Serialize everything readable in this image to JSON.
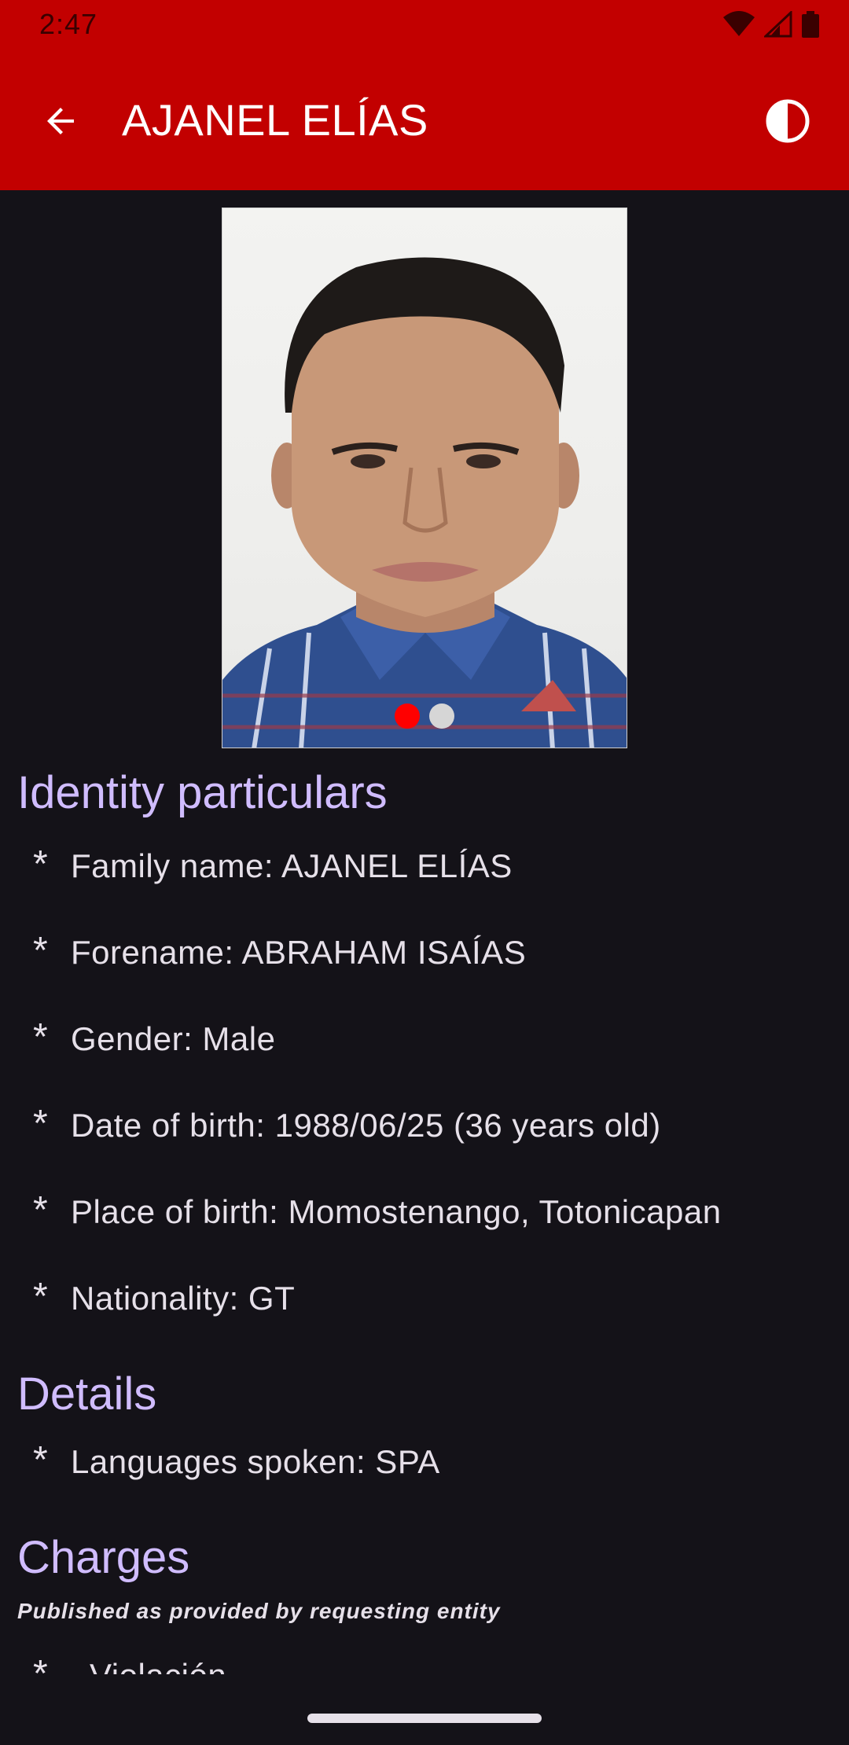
{
  "status_bar": {
    "time": "2:47",
    "icons": [
      "wifi-icon",
      "signal-icon",
      "battery-icon"
    ]
  },
  "app_bar": {
    "title": "AJANEL ELÍAS",
    "back_icon": "arrow-back-icon",
    "theme_icon": "contrast-icon"
  },
  "carousel": {
    "image_count": 2,
    "active_index": 0
  },
  "sections": {
    "identity": {
      "title": "Identity particulars",
      "items": [
        "Family name: AJANEL ELÍAS",
        "Forename: ABRAHAM ISAÍAS",
        "Gender: Male",
        "Date of birth: 1988/06/25 (36 years old)",
        "Place of birth: Momostenango, Totonicapan",
        "Nationality: GT"
      ]
    },
    "details": {
      "title": "Details",
      "items": [
        "Languages spoken: SPA"
      ]
    },
    "charges": {
      "title": "Charges",
      "note": "Published as provided by requesting entity",
      "items": [
        "Violación"
      ]
    }
  },
  "bullet": "*",
  "colors": {
    "app_bar": "#c20000",
    "background": "#141218",
    "section_title": "#d0bcff",
    "text": "#e6e0e9",
    "dot_active": "#ff0000",
    "dot_inactive": "#d6d6d6"
  }
}
